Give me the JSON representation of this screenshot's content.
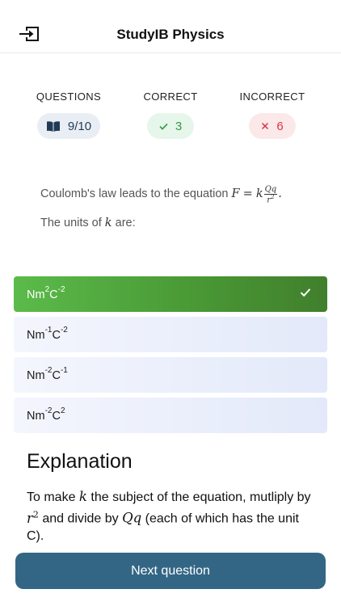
{
  "header": {
    "title": "StudyIB Physics",
    "exit_icon": "exit-icon"
  },
  "stats": {
    "questions": {
      "label": "QUESTIONS",
      "value": "9/10",
      "icon": "book-icon"
    },
    "correct": {
      "label": "CORRECT",
      "value": "3",
      "icon": "check-icon"
    },
    "incorrect": {
      "label": "INCORRECT",
      "value": "6",
      "icon": "cross-icon"
    }
  },
  "question": {
    "intro": "Coulomb's law leads to the equation",
    "eq_F": "F",
    "eq_equals": "=",
    "eq_k": "k",
    "eq_num": "Qq",
    "eq_den_base": "r",
    "eq_den_exp": "2",
    "eq_end": ".",
    "line2_prefix": "The units of",
    "line2_var": "k",
    "line2_suffix": "are:"
  },
  "options": [
    {
      "p1": "Nm",
      "s1": "2",
      "p2": "C",
      "s2": "-2",
      "state": "correct"
    },
    {
      "p1": "Nm",
      "s1": "-1",
      "p2": "C",
      "s2": "-2",
      "state": "normal"
    },
    {
      "p1": "Nm",
      "s1": "-2",
      "p2": "C",
      "s2": "-1",
      "state": "normal"
    },
    {
      "p1": "Nm",
      "s1": "-2",
      "p2": "C",
      "s2": "2",
      "state": "normal"
    }
  ],
  "explanation": {
    "title": "Explanation",
    "t1": "To make",
    "v1": "k",
    "t2": "the subject of the equation, mutliply by",
    "v2": "r",
    "v2_exp": "2",
    "t3": "and divide by",
    "v3": "Qq",
    "t4": "(each of which has the unit C)."
  },
  "next_button": {
    "label": "Next question"
  },
  "colors": {
    "primary": "#336685",
    "correct": "#4a9a36",
    "correct_text": "#2f9a43",
    "incorrect_text": "#d9343e"
  }
}
